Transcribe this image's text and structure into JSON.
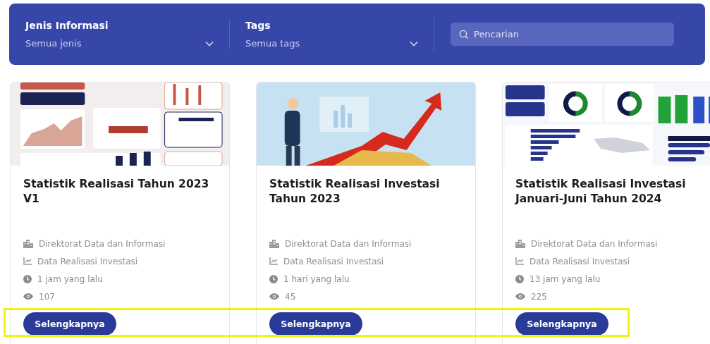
{
  "filters": [
    {
      "label": "Jenis Informasi",
      "value": "Semua jenis"
    },
    {
      "label": "Tags",
      "value": "Semua tags"
    }
  ],
  "search": {
    "placeholder": "Pencarian"
  },
  "cards": [
    {
      "title": "Statistik Realisasi Tahun 2023 V1",
      "publisher": "Direktorat Data dan Informasi",
      "category": "Data Realisasi Investasi",
      "time": "1 jam yang lalu",
      "views": "107",
      "button": "Selengkapnya"
    },
    {
      "title": "Statistik Realisasi Investasi Tahun 2023",
      "publisher": "Direktorat Data dan Informasi",
      "category": "Data Realisasi Investasi",
      "time": "1 hari yang lalu",
      "views": "45",
      "button": "Selengkapnya"
    },
    {
      "title": "Statistik Realisasi Investasi Januari-Juni Tahun 2024",
      "publisher": "Direktorat Data dan Informasi",
      "category": "Data Realisasi Investasi",
      "time": "13 jam yang lalu",
      "views": "225",
      "button": "Selengkapnya"
    }
  ]
}
